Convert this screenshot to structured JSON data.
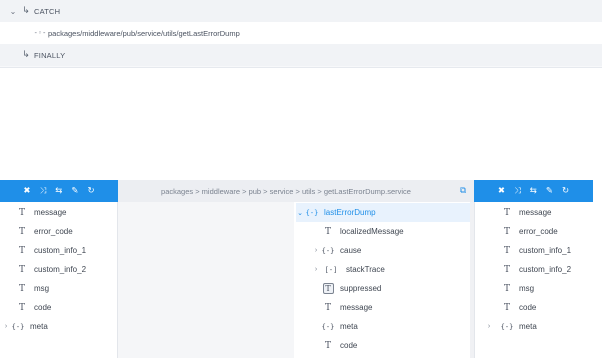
{
  "flow": {
    "catch": {
      "label": "CATCH",
      "icon": "catch-step-icon"
    },
    "invoke": {
      "label": "packages/middleware/pub/service/utils/getLastErrorDump",
      "icon": "invoke-service-icon"
    },
    "finally": {
      "label": "FINALLY",
      "icon": "finally-step-icon"
    }
  },
  "toolbar": {
    "icons": [
      "close-icon",
      "shuffle-icon",
      "transform-icon",
      "edit-icon",
      "refresh-icon"
    ]
  },
  "breadcrumb": {
    "text": "packages > middleware > pub > service > utils > getLastErrorDump.service"
  },
  "left_pane": {
    "fields": [
      {
        "label": "message",
        "type": "string"
      },
      {
        "label": "error_code",
        "type": "string"
      },
      {
        "label": "custom_info_1",
        "type": "string"
      },
      {
        "label": "custom_info_2",
        "type": "string"
      },
      {
        "label": "msg",
        "type": "string"
      },
      {
        "label": "code",
        "type": "string"
      },
      {
        "label": "meta",
        "type": "document"
      }
    ]
  },
  "middle_pane": {
    "fields": [
      {
        "label": "lastErrorDump",
        "type": "document",
        "expanded": true,
        "selected": true
      },
      {
        "label": "localizedMessage",
        "type": "string"
      },
      {
        "label": "cause",
        "type": "document"
      },
      {
        "label": "stackTrace",
        "type": "document-list"
      },
      {
        "label": "suppressed",
        "type": "string-list"
      },
      {
        "label": "message",
        "type": "string"
      },
      {
        "label": "meta",
        "type": "document"
      },
      {
        "label": "code",
        "type": "string"
      }
    ]
  },
  "right_pane": {
    "fields": [
      {
        "label": "message",
        "type": "string"
      },
      {
        "label": "error_code",
        "type": "string"
      },
      {
        "label": "custom_info_1",
        "type": "string"
      },
      {
        "label": "custom_info_2",
        "type": "string"
      },
      {
        "label": "msg",
        "type": "string"
      },
      {
        "label": "code",
        "type": "string"
      },
      {
        "label": "meta",
        "type": "document"
      }
    ]
  },
  "colors": {
    "accent": "#1f8fe8",
    "selected_bg": "#e8f2fd"
  }
}
